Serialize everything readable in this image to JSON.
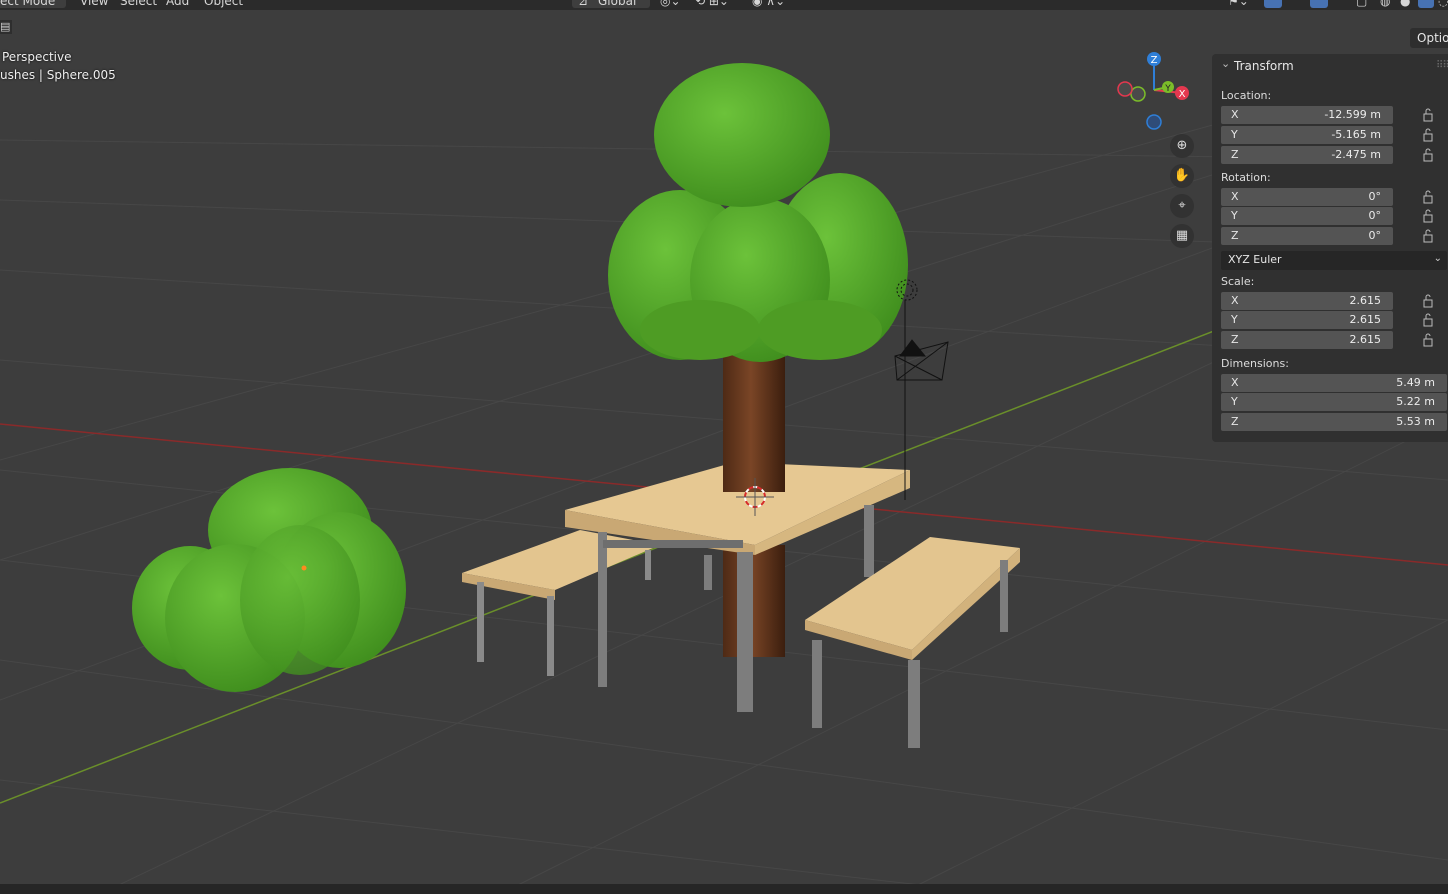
{
  "header": {
    "mode_label": "ect Mode",
    "menus": [
      "View",
      "Select",
      "Add",
      "Object"
    ],
    "orientation": "Global",
    "options_label": "Option"
  },
  "viewport": {
    "view_label": "Perspective",
    "object_label": "ushes | Sphere.005"
  },
  "gizmo": {
    "axes": [
      {
        "label": "Z",
        "color": "#2f7fd8"
      },
      {
        "label": "Y",
        "color": "#7bbd29"
      },
      {
        "label": "X",
        "color": "#e4384f"
      }
    ]
  },
  "nav_buttons": [
    "zoom-icon",
    "hand-icon",
    "camera-icon",
    "grid-icon"
  ],
  "transform_panel": {
    "title": "Transform",
    "location_label": "Location:",
    "location": [
      {
        "axis": "X",
        "value": "-12.599 m"
      },
      {
        "axis": "Y",
        "value": "-5.165 m"
      },
      {
        "axis": "Z",
        "value": "-2.475 m"
      }
    ],
    "rotation_label": "Rotation:",
    "rotation": [
      {
        "axis": "X",
        "value": "0°"
      },
      {
        "axis": "Y",
        "value": "0°"
      },
      {
        "axis": "Z",
        "value": "0°"
      }
    ],
    "rotation_mode": "XYZ Euler",
    "scale_label": "Scale:",
    "scale": [
      {
        "axis": "X",
        "value": "2.615"
      },
      {
        "axis": "Y",
        "value": "2.615"
      },
      {
        "axis": "Z",
        "value": "2.615"
      }
    ],
    "dimensions_label": "Dimensions:",
    "dimensions": [
      {
        "axis": "X",
        "value": "5.49 m"
      },
      {
        "axis": "Y",
        "value": "5.22 m"
      },
      {
        "axis": "Z",
        "value": "5.53 m"
      }
    ]
  },
  "colors": {
    "viewport_bg": "#3d3d3d",
    "foliage": "#5aa62c",
    "trunk": "#6e3b1f",
    "wood": "#e3c58f",
    "x_axis_line": "#8a2a2a",
    "y_axis_line": "#6a8f2a"
  }
}
